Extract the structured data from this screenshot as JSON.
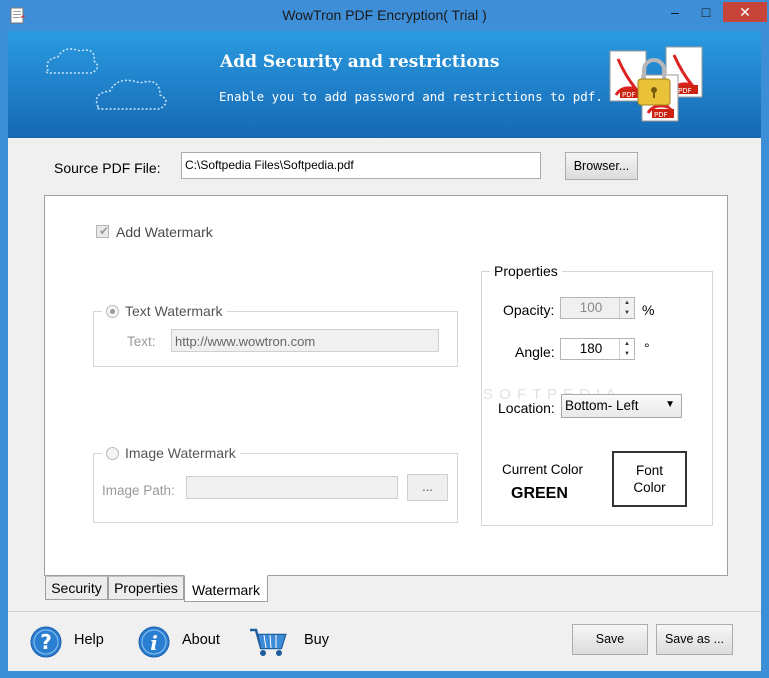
{
  "window": {
    "title": "WowTron PDF Encryption( Trial )",
    "controls": {
      "minimize": "–",
      "maximize": "□",
      "close": "✕"
    }
  },
  "banner": {
    "title": "Add Security and restrictions",
    "subtitle": "Enable you to add password and restrictions to pdf.",
    "pdf_label": "PDF"
  },
  "source": {
    "label": "Source PDF File:",
    "value": "C:\\Softpedia Files\\Softpedia.pdf",
    "browse_label": "Browser..."
  },
  "watermark": {
    "add_watermark_label": "Add Watermark",
    "add_watermark_checked": true,
    "text_group": {
      "legend": "Text Watermark",
      "selected": true,
      "text_label": "Text:",
      "text_value": "http://www.wowtron.com"
    },
    "image_group": {
      "legend": "Image Watermark",
      "selected": false,
      "path_label": "Image Path:",
      "path_value": "",
      "browse_label": "..."
    }
  },
  "properties": {
    "legend": "Properties",
    "opacity_label": "Opacity:",
    "opacity_value": "100",
    "opacity_unit": "%",
    "angle_label": "Angle:",
    "angle_value": "180",
    "angle_unit": "°",
    "location_label": "Location:",
    "location_value": "Bottom- Left",
    "current_color_label": "Current Color",
    "current_color_value": "GREEN",
    "font_color_line1": "Font",
    "font_color_line2": "Color"
  },
  "tabs": [
    {
      "label": "Security",
      "active": false
    },
    {
      "label": "Properties",
      "active": false
    },
    {
      "label": "Watermark",
      "active": true
    }
  ],
  "footer": {
    "help_label": "Help",
    "about_label": "About",
    "buy_label": "Buy",
    "save_label": "Save",
    "save_as_label": "Save as ..."
  },
  "icons": {
    "help": "question-icon",
    "about": "info-icon",
    "buy": "cart-icon"
  },
  "colors": {
    "title_bar": "#3f8fd8",
    "banner_top": "#2a9be0",
    "banner_bottom": "#1668b3",
    "close_button": "#c7443a",
    "help_icon": "#2b7fd1"
  }
}
